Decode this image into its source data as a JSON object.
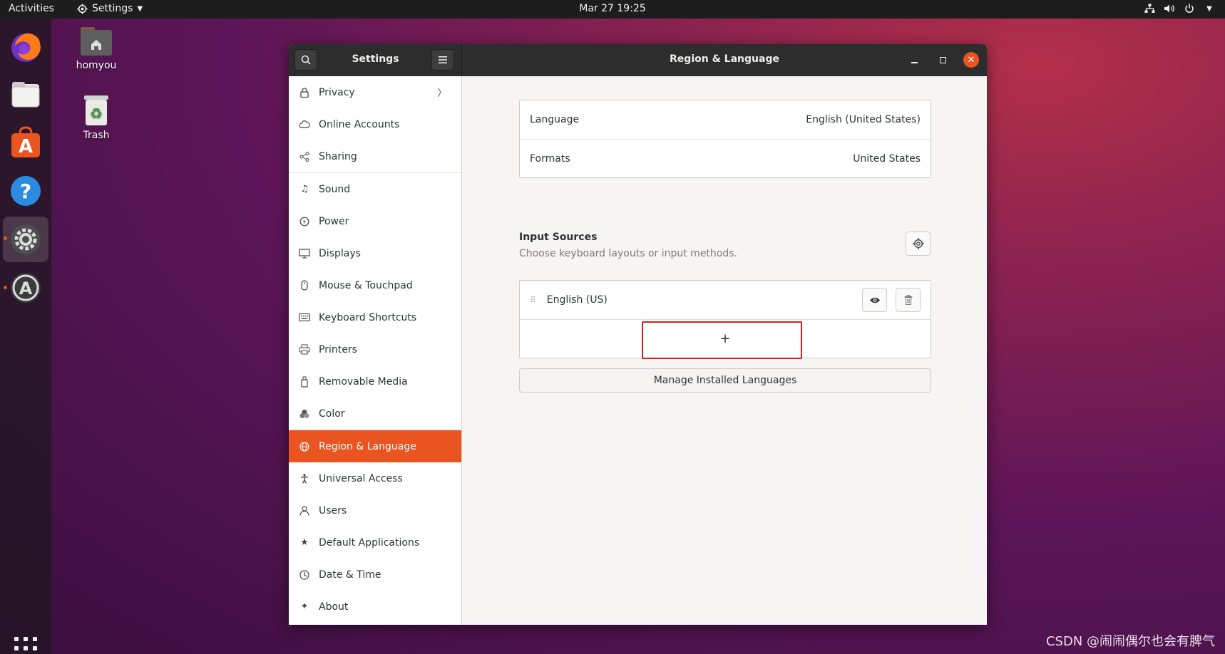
{
  "topbar": {
    "activities": "Activities",
    "app_menu": "Settings",
    "clock": "Mar 27  19:25"
  },
  "desktop": {
    "home_label": "homyou",
    "trash_label": "Trash"
  },
  "window": {
    "sidebar_title": "Settings",
    "page_title": "Region & Language"
  },
  "sidebar": {
    "items": [
      {
        "label": "Privacy",
        "icon": "lock-icon"
      },
      {
        "label": "Online Accounts",
        "icon": "cloud-icon"
      },
      {
        "label": "Sharing",
        "icon": "share-icon"
      },
      {
        "label": "Sound",
        "icon": "music-note-icon"
      },
      {
        "label": "Power",
        "icon": "power-icon"
      },
      {
        "label": "Displays",
        "icon": "display-icon"
      },
      {
        "label": "Mouse & Touchpad",
        "icon": "mouse-icon"
      },
      {
        "label": "Keyboard Shortcuts",
        "icon": "keyboard-icon"
      },
      {
        "label": "Printers",
        "icon": "printer-icon"
      },
      {
        "label": "Removable Media",
        "icon": "usb-icon"
      },
      {
        "label": "Color",
        "icon": "color-icon"
      },
      {
        "label": "Region & Language",
        "icon": "globe-icon",
        "selected": true
      },
      {
        "label": "Universal Access",
        "icon": "accessibility-icon"
      },
      {
        "label": "Users",
        "icon": "user-icon"
      },
      {
        "label": "Default Applications",
        "icon": "star-icon"
      },
      {
        "label": "Date & Time",
        "icon": "clock-icon"
      },
      {
        "label": "About",
        "icon": "sparkle-icon"
      }
    ]
  },
  "region": {
    "language_label": "Language",
    "language_value": "English (United States)",
    "formats_label": "Formats",
    "formats_value": "United States",
    "input_sources_title": "Input Sources",
    "input_sources_subtitle": "Choose keyboard layouts or input methods.",
    "input_source": "English (US)",
    "add_symbol": "+",
    "manage_button": "Manage Installed Languages"
  },
  "watermark": "CSDN @闹闹偶尔也会有脾气",
  "colors": {
    "accent": "#e95420",
    "highlight_box": "#e0191b",
    "headerbar": "#2d2d2d"
  }
}
